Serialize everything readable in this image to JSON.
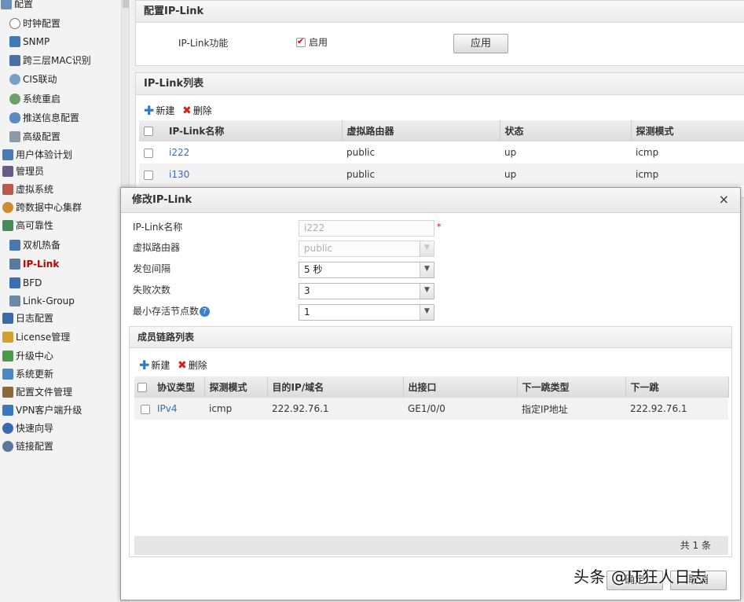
{
  "sidebar": {
    "items": [
      {
        "label": "配置",
        "icon": "config-icon"
      },
      {
        "label": "时钟配置",
        "icon": "clock-icon"
      },
      {
        "label": "SNMP",
        "icon": "snmp-icon"
      },
      {
        "label": "跨三层MAC识别",
        "icon": "monitor-icon"
      },
      {
        "label": "CIS联动",
        "icon": "cis-icon"
      },
      {
        "label": "系统重启",
        "icon": "restart-icon"
      },
      {
        "label": "推送信息配置",
        "icon": "message-icon"
      },
      {
        "label": "高级配置",
        "icon": "advanced-icon"
      },
      {
        "label": "用户体验计划",
        "icon": "user-plan-icon"
      },
      {
        "label": "管理员",
        "icon": "admin-icon"
      },
      {
        "label": "虚拟系统",
        "icon": "virtual-system-icon"
      },
      {
        "label": "跨数据中心集群",
        "icon": "cluster-icon"
      },
      {
        "label": "高可靠性",
        "icon": "reliability-icon"
      },
      {
        "label": "双机热备",
        "icon": "hot-standby-icon"
      },
      {
        "label": "IP-Link",
        "icon": "ip-link-icon"
      },
      {
        "label": "BFD",
        "icon": "bfd-icon"
      },
      {
        "label": "Link-Group",
        "icon": "link-group-icon"
      },
      {
        "label": "日志配置",
        "icon": "log-icon"
      },
      {
        "label": "License管理",
        "icon": "license-icon"
      },
      {
        "label": "升级中心",
        "icon": "upgrade-icon"
      },
      {
        "label": "系统更新",
        "icon": "update-icon"
      },
      {
        "label": "配置文件管理",
        "icon": "config-file-icon"
      },
      {
        "label": "VPN客户端升级",
        "icon": "vpn-icon"
      },
      {
        "label": "快速向导",
        "icon": "wizard-icon"
      },
      {
        "label": "链接配置",
        "icon": "link-config-icon"
      }
    ]
  },
  "config_panel": {
    "title": "配置IP-Link",
    "feature_label": "IP-Link功能",
    "enable_label": "启用",
    "enabled": true,
    "apply_label": "应用"
  },
  "list_panel": {
    "title": "IP-Link列表",
    "new_label": "新建",
    "delete_label": "删除",
    "columns": [
      "IP-Link名称",
      "虚拟路由器",
      "状态",
      "探测模式"
    ],
    "rows": [
      {
        "name": "i222",
        "vrouter": "public",
        "status": "up",
        "mode": "icmp"
      },
      {
        "name": "i130",
        "vrouter": "public",
        "status": "up",
        "mode": "icmp"
      }
    ]
  },
  "modal": {
    "title": "修改IP-Link",
    "close": "×",
    "fields": {
      "name_label": "IP-Link名称",
      "name_value": "i222",
      "required_mark": "*",
      "vrouter_label": "虚拟路由器",
      "vrouter_value": "public",
      "interval_label": "发包间隔",
      "interval_value": "5 秒",
      "fail_label": "失败次数",
      "fail_value": "3",
      "min_label": "最小存活节点数",
      "min_value": "1",
      "help_glyph": "?"
    },
    "members": {
      "title": "成员链路列表",
      "new_label": "新建",
      "delete_label": "删除",
      "columns": [
        "协议类型",
        "探测模式",
        "目的IP/域名",
        "出接口",
        "下一跳类型",
        "下一跳"
      ],
      "rows": [
        {
          "protocol": "IPv4",
          "mode": "icmp",
          "dest": "222.92.76.1",
          "iface": "GE1/0/0",
          "nexthop_type": "指定IP地址",
          "nexthop": "222.92.76.1"
        }
      ],
      "total": "共 1 条"
    },
    "ok_label": "确定",
    "cancel_label": "取消"
  },
  "watermark": "头条 @IT狂人日志",
  "colors": {
    "active_nav": "#c00000",
    "link": "#2a6fc9",
    "add_icon": "#2a7ac8",
    "delete_icon": "#d42020"
  }
}
